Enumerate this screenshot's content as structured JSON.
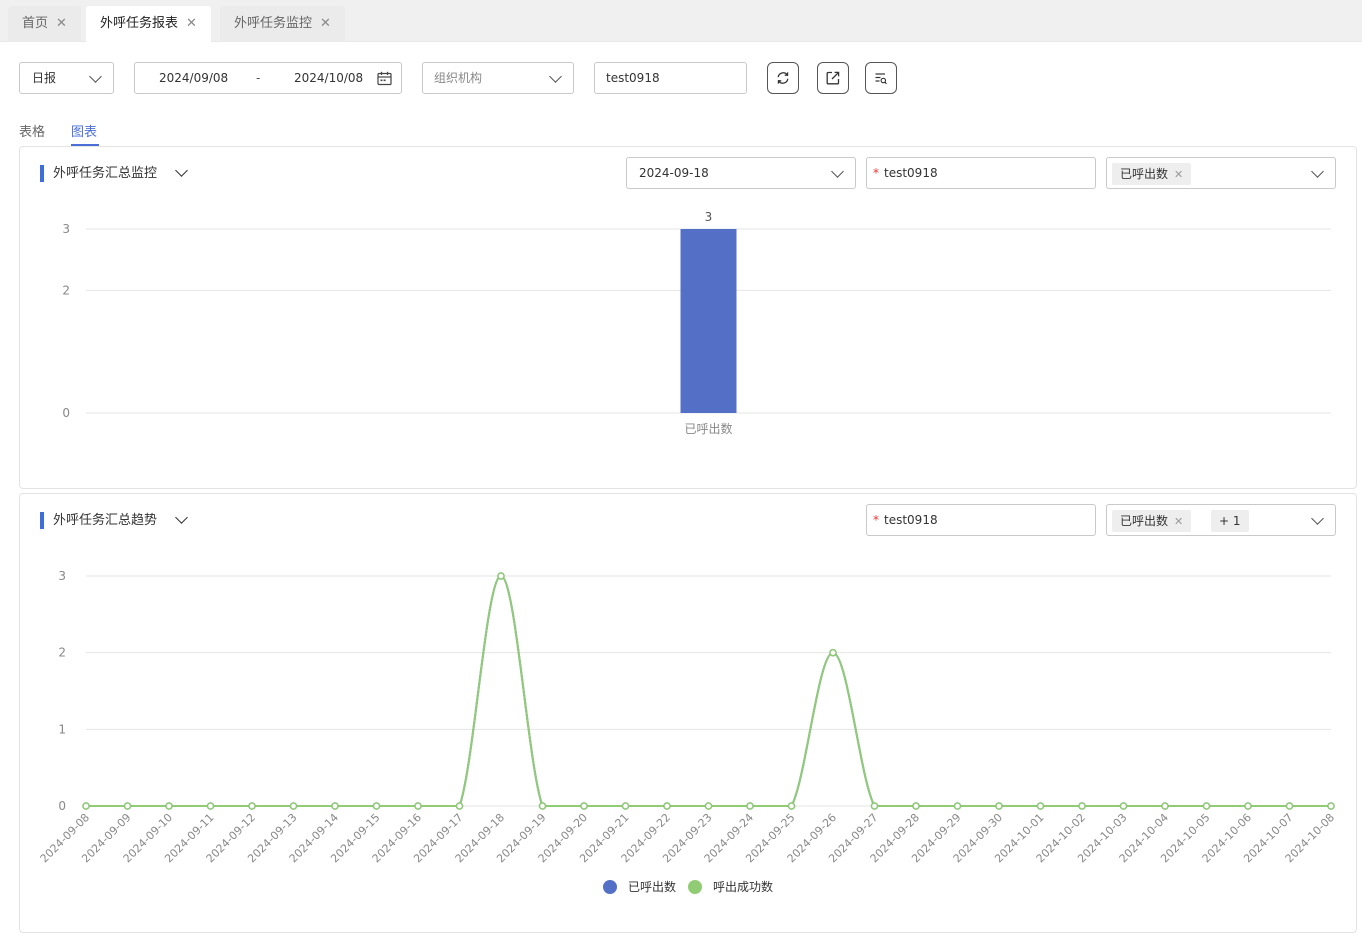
{
  "tabs": [
    {
      "label": "首页",
      "active": false
    },
    {
      "label": "外呼任务报表",
      "active": true
    },
    {
      "label": "外呼任务监控",
      "active": false
    }
  ],
  "toolbar": {
    "period": "日报",
    "date_start": "2024/09/08",
    "date_sep": "-",
    "date_end": "2024/10/08",
    "org_placeholder": "组织机构",
    "task_value": "test0918"
  },
  "view_tabs": [
    {
      "label": "表格",
      "active": false
    },
    {
      "label": "图表",
      "active": true
    }
  ],
  "panel1": {
    "title": "外呼任务汇总监控",
    "date": "2024-09-18",
    "task": "test0918",
    "metric_tag": "已呼出数"
  },
  "panel2": {
    "title": "外呼任务汇总趋势",
    "task": "test0918",
    "metric_tag": "已呼出数",
    "more_count": "+ 1"
  },
  "colors": {
    "accent": "#4a6fd8",
    "bar": "#5470c6",
    "line_green": "#91cc75"
  },
  "chart_data": [
    {
      "type": "bar",
      "categories": [
        "已呼出数"
      ],
      "values": [
        3
      ],
      "data_labels": [
        "3"
      ],
      "y_ticks": [
        "0",
        "2",
        "3"
      ],
      "ylim": [
        0,
        3
      ],
      "grid": true
    },
    {
      "type": "line",
      "x": [
        "2024-09-08",
        "2024-09-09",
        "2024-09-10",
        "2024-09-11",
        "2024-09-12",
        "2024-09-13",
        "2024-09-14",
        "2024-09-15",
        "2024-09-16",
        "2024-09-17",
        "2024-09-18",
        "2024-09-19",
        "2024-09-20",
        "2024-09-21",
        "2024-09-22",
        "2024-09-23",
        "2024-09-24",
        "2024-09-25",
        "2024-09-26",
        "2024-09-27",
        "2024-09-28",
        "2024-09-29",
        "2024-09-30",
        "2024-10-01",
        "2024-10-02",
        "2024-10-03",
        "2024-10-04",
        "2024-10-05",
        "2024-10-06",
        "2024-10-07",
        "2024-10-08"
      ],
      "series": [
        {
          "name": "已呼出数",
          "color": "#5470c6",
          "values": [
            0,
            0,
            0,
            0,
            0,
            0,
            0,
            0,
            0,
            0,
            3,
            0,
            0,
            0,
            0,
            0,
            0,
            0,
            2,
            0,
            0,
            0,
            0,
            0,
            0,
            0,
            0,
            0,
            0,
            0,
            0
          ]
        },
        {
          "name": "呼出成功数",
          "color": "#91cc75",
          "values": [
            0,
            0,
            0,
            0,
            0,
            0,
            0,
            0,
            0,
            0,
            3,
            0,
            0,
            0,
            0,
            0,
            0,
            0,
            2,
            0,
            0,
            0,
            0,
            0,
            0,
            0,
            0,
            0,
            0,
            0,
            0
          ]
        }
      ],
      "y_ticks": [
        "0",
        "1",
        "2",
        "3"
      ],
      "ylim": [
        0,
        3
      ],
      "legend": "bottom-center",
      "grid": true
    }
  ]
}
